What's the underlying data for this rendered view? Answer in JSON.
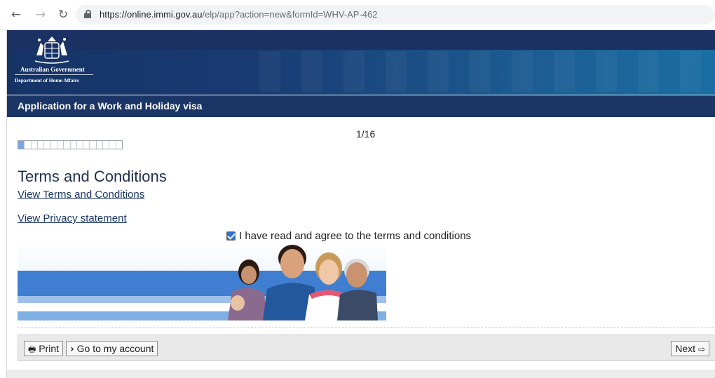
{
  "browser": {
    "back_icon": "arrow-left-icon",
    "forward_icon": "arrow-right-icon",
    "reload_icon": "reload-icon",
    "url_host": "https://online.immi.gov.au",
    "url_path": "/elp/app?action=new&formId=WHV-AP-462"
  },
  "header": {
    "gov_name": "Australian Government",
    "department": "Department of Home Affairs",
    "brand_color": "#1b3567"
  },
  "form": {
    "title": "Application for a Work and Holiday visa",
    "step_label": "1/16",
    "progress": {
      "current": 1,
      "total": 16
    }
  },
  "content": {
    "section_title": "Terms and Conditions",
    "terms_link": "View Terms and Conditions",
    "privacy_link": "View Privacy statement",
    "agree_label": "I have read and agree to the terms and conditions",
    "agree_checked": true
  },
  "toolbar": {
    "print_label": "Print",
    "account_label": "Go to my account",
    "next_label": "Next"
  }
}
